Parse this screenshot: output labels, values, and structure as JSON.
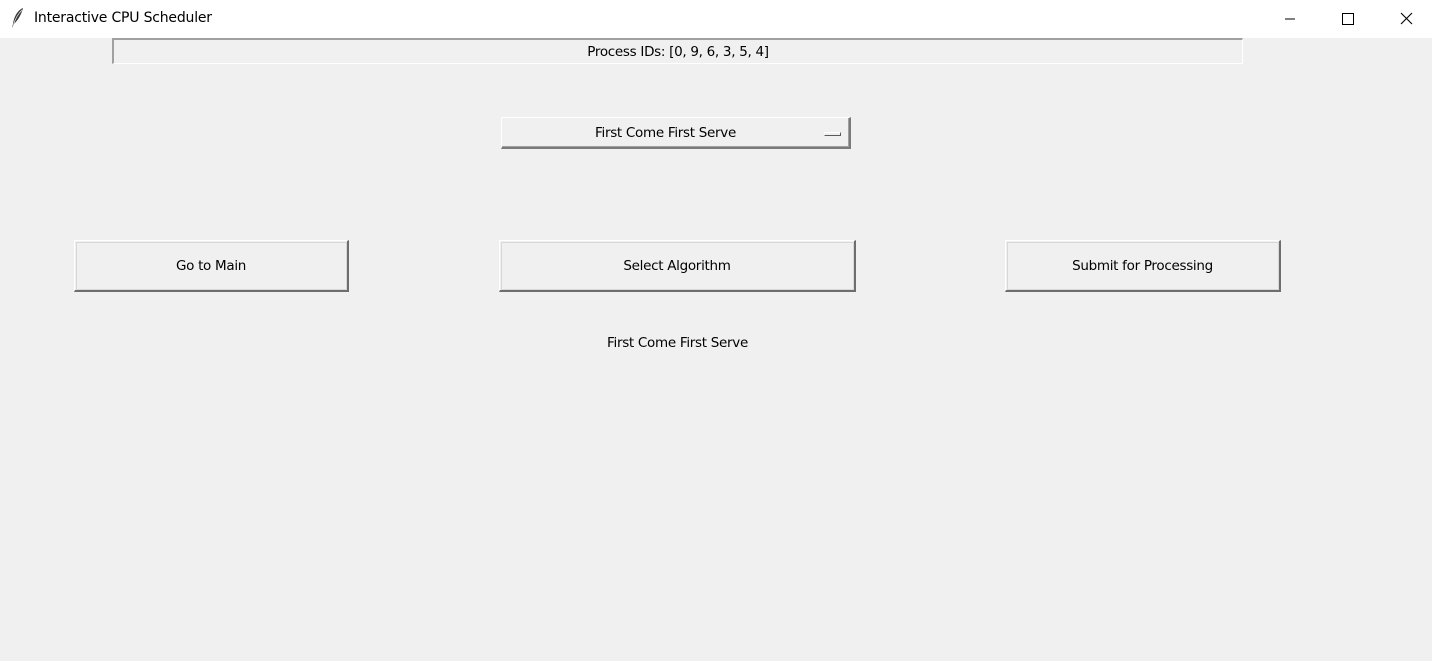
{
  "window": {
    "title": "Interactive CPU Scheduler",
    "app_icon": "feather-icon",
    "controls": {
      "minimize_icon": "minimize-icon",
      "maximize_icon": "maximize-icon",
      "close_icon": "close-icon"
    }
  },
  "process_ids_label": "Process IDs: [0, 9, 6, 3, 5, 4]",
  "algorithm_menu": {
    "selected": "First Come First Serve"
  },
  "buttons": {
    "go_to_main": "Go to Main",
    "select_algorithm": "Select Algorithm",
    "submit": "Submit for Processing"
  },
  "selected_algorithm_label": "First Come First Serve",
  "colors": {
    "background": "#f0f0f0",
    "titlebar": "#ffffff",
    "text": "#000000"
  }
}
